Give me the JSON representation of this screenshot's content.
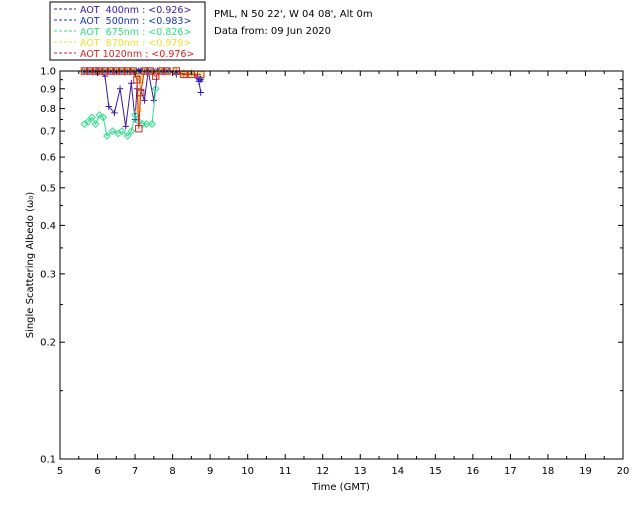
{
  "header": {
    "site_line": "PML, N 50 22', W 04 08', Alt 0m",
    "date_line": "Data from: 09 Jun 2020"
  },
  "chart_data": {
    "type": "line",
    "xlabel": "Time (GMT)",
    "ylabel": "Single Scattering Albedo (ω₀)",
    "xlim": [
      5,
      20
    ],
    "ylim": [
      0.1,
      1.0
    ],
    "yscale": "log",
    "x_ticks": [
      "5",
      "6",
      "7",
      "8",
      "9",
      "10",
      "11",
      "12",
      "13",
      "14",
      "15",
      "16",
      "17",
      "18",
      "19",
      "20"
    ],
    "y_ticks": [
      "0.1",
      "0.2",
      "0.3",
      "0.4",
      "0.5",
      "0.6",
      "0.7",
      "0.8",
      "0.9",
      "1.0"
    ],
    "grid": false,
    "legend_position": "top-left, outside plot",
    "series": [
      {
        "name": "AOT  400nm : <0.926>",
        "color": "#3a1aa0",
        "marker": "plus",
        "x": [
          5.65,
          5.8,
          5.95,
          6.05,
          6.2,
          6.3,
          6.45,
          6.6,
          6.75,
          6.9,
          7.0,
          7.05,
          7.1,
          7.15,
          7.25,
          7.35,
          7.5,
          7.6,
          7.75,
          7.9,
          8.1,
          8.3,
          8.5,
          8.7,
          8.75
        ],
        "y": [
          1.0,
          1.0,
          1.0,
          1.0,
          0.97,
          0.81,
          0.78,
          0.9,
          0.72,
          0.93,
          0.75,
          0.9,
          1.0,
          0.89,
          0.84,
          1.0,
          0.84,
          1.0,
          1.0,
          1.0,
          0.98,
          0.98,
          0.99,
          0.94,
          0.88
        ]
      },
      {
        "name": "AOT  500nm : <0.983>",
        "color": "#1a33c8",
        "marker": "star",
        "x": [
          5.65,
          5.8,
          5.95,
          6.05,
          6.2,
          6.35,
          6.5,
          6.65,
          6.8,
          6.95,
          7.05,
          7.1,
          7.15,
          7.25,
          7.4,
          7.55,
          7.7,
          7.85,
          8.1,
          8.3,
          8.5,
          8.7,
          8.75
        ],
        "y": [
          1.0,
          1.0,
          1.0,
          1.0,
          1.0,
          1.0,
          1.0,
          1.0,
          1.0,
          1.0,
          0.99,
          1.0,
          1.0,
          1.0,
          1.0,
          1.0,
          1.0,
          1.0,
          0.99,
          0.99,
          0.99,
          0.96,
          0.95
        ]
      },
      {
        "name": "AOT  675nm : <0.826>",
        "color": "#2ee08a",
        "marker": "diamond",
        "x": [
          5.65,
          5.75,
          5.85,
          5.95,
          6.05,
          6.15,
          6.25,
          6.4,
          6.55,
          6.65,
          6.8,
          6.9,
          7.0,
          7.1,
          7.2,
          7.3,
          7.45,
          7.55
        ],
        "y": [
          0.73,
          0.74,
          0.76,
          0.73,
          0.77,
          0.76,
          0.68,
          0.7,
          0.69,
          0.7,
          0.68,
          0.7,
          0.77,
          0.74,
          0.73,
          0.73,
          0.73,
          0.9
        ],
        "extra_value_labels": []
      },
      {
        "name": "AOT  870nm : <0.979>",
        "color": "#f0e030",
        "marker": "triangle",
        "x": [
          5.65,
          5.8,
          5.95,
          6.05,
          6.2,
          6.35,
          6.5,
          6.65,
          6.8,
          6.95,
          7.05,
          7.1,
          7.15,
          7.25,
          7.4,
          7.55,
          7.7,
          7.85,
          8.1,
          8.3,
          8.5,
          8.75
        ],
        "y": [
          1.0,
          1.0,
          1.0,
          1.0,
          1.0,
          1.0,
          1.0,
          1.0,
          1.0,
          1.0,
          0.98,
          0.8,
          0.95,
          1.0,
          1.0,
          0.99,
          1.0,
          1.0,
          1.0,
          0.99,
          0.99,
          0.98
        ]
      },
      {
        "name": "AOT 1020nm : <0.976>",
        "color": "#e02020",
        "marker": "square",
        "x": [
          5.65,
          5.8,
          5.95,
          6.05,
          6.2,
          6.35,
          6.5,
          6.65,
          6.8,
          6.95,
          7.05,
          7.1,
          7.15,
          7.25,
          7.4,
          7.55,
          7.7,
          7.85,
          8.1,
          8.3,
          8.5,
          8.75
        ],
        "y": [
          1.0,
          1.0,
          1.0,
          1.0,
          1.0,
          1.0,
          1.0,
          1.0,
          1.0,
          1.0,
          0.95,
          0.71,
          0.88,
          1.0,
          1.0,
          0.97,
          1.0,
          1.0,
          1.0,
          0.98,
          0.98,
          0.98
        ]
      }
    ]
  }
}
